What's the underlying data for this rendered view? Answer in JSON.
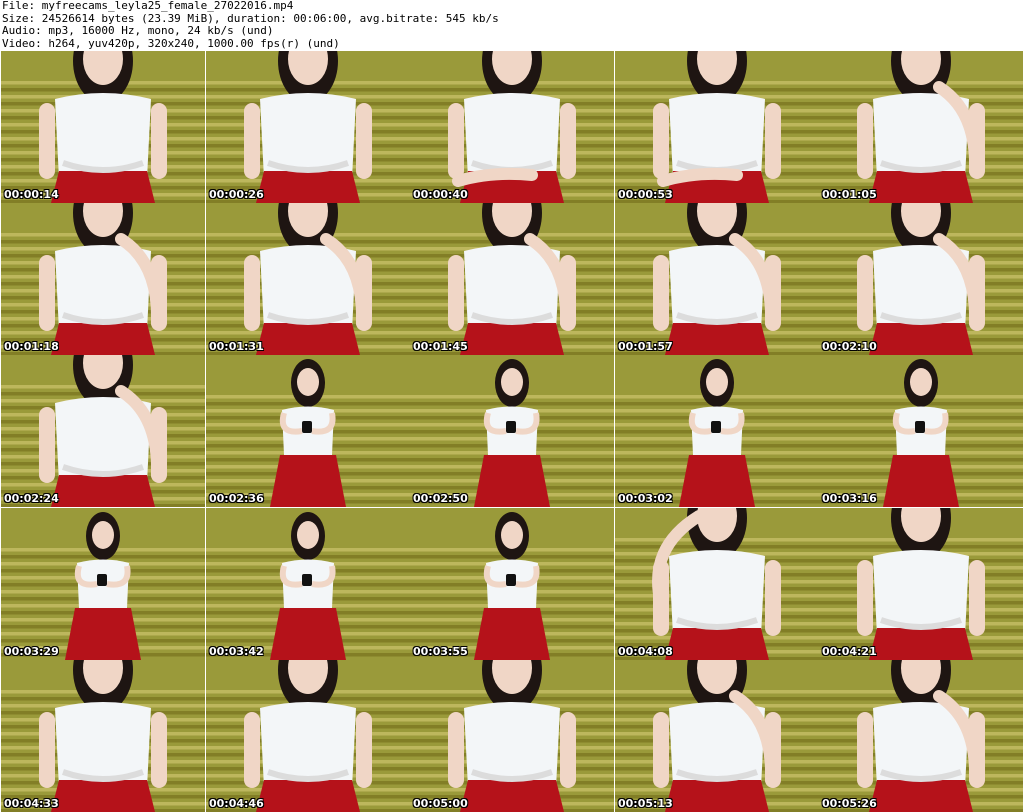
{
  "header": {
    "file_line": "File: myfreecams_leyla25_female_27022016.mp4",
    "size_line": "Size: 24526614 bytes (23.39 MiB), duration: 00:06:00, avg.bitrate: 545 kb/s",
    "audio_line": "Audio: mp3, 16000 Hz, mono, 24 kb/s (und)",
    "video_line": "Video: h264, yuv420p, 320x240, 1000.00 fps(r) (und)"
  },
  "thumbnails": [
    {
      "timestamp": "00:00:14",
      "pose": "close"
    },
    {
      "timestamp": "00:00:26",
      "pose": "close"
    },
    {
      "timestamp": "00:00:40",
      "pose": "lean"
    },
    {
      "timestamp": "00:00:53",
      "pose": "lean"
    },
    {
      "timestamp": "00:01:05",
      "pose": "chin"
    },
    {
      "timestamp": "00:01:18",
      "pose": "chin"
    },
    {
      "timestamp": "00:01:31",
      "pose": "chin"
    },
    {
      "timestamp": "00:01:45",
      "pose": "chin"
    },
    {
      "timestamp": "00:01:57",
      "pose": "chin"
    },
    {
      "timestamp": "00:02:10",
      "pose": "chin"
    },
    {
      "timestamp": "00:02:24",
      "pose": "chin"
    },
    {
      "timestamp": "00:02:36",
      "pose": "phone"
    },
    {
      "timestamp": "00:02:50",
      "pose": "phone"
    },
    {
      "timestamp": "00:03:02",
      "pose": "phone"
    },
    {
      "timestamp": "00:03:16",
      "pose": "phone"
    },
    {
      "timestamp": "00:03:29",
      "pose": "phone"
    },
    {
      "timestamp": "00:03:42",
      "pose": "phone"
    },
    {
      "timestamp": "00:03:55",
      "pose": "phone"
    },
    {
      "timestamp": "00:04:08",
      "pose": "arm"
    },
    {
      "timestamp": "00:04:21",
      "pose": "close"
    },
    {
      "timestamp": "00:04:33",
      "pose": "close"
    },
    {
      "timestamp": "00:04:46",
      "pose": "close"
    },
    {
      "timestamp": "00:05:00",
      "pose": "close"
    },
    {
      "timestamp": "00:05:13",
      "pose": "chin"
    },
    {
      "timestamp": "00:05:26",
      "pose": "chin"
    }
  ],
  "colors": {
    "sofa_light": "#c8c06a",
    "sofa_dark": "#7a7420",
    "wall": "#9a9a3a",
    "skin": "#f0d6c6",
    "hair": "#1e1512",
    "top": "#f3f6f8",
    "skirt": "#b5121a"
  }
}
